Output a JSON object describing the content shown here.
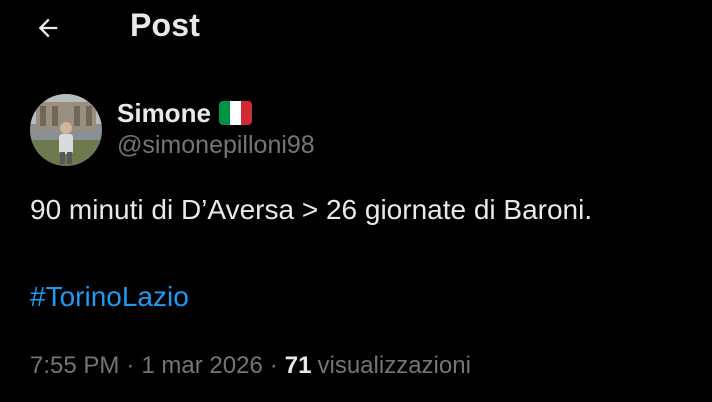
{
  "header": {
    "title": "Post",
    "back_icon": "arrow-left-icon"
  },
  "author": {
    "display_name": "Simone",
    "handle": "@simonepilloni98",
    "badge_icon": "italy-flag-icon",
    "flag_colors": [
      "#009246",
      "#ffffff",
      "#ce2b37"
    ]
  },
  "post": {
    "text": "90 minuti di D’Aversa > 26 giornate di Baroni.",
    "hashtag": "#TorinoLazio"
  },
  "meta": {
    "time": "7:55 PM",
    "separator": "·",
    "date": "1 mar 2026",
    "views_count": "71",
    "views_label": "visualizzazioni"
  },
  "colors": {
    "background": "#000000",
    "text_primary": "#e7e9ea",
    "text_secondary": "#71767b",
    "link": "#1d9bf0"
  }
}
